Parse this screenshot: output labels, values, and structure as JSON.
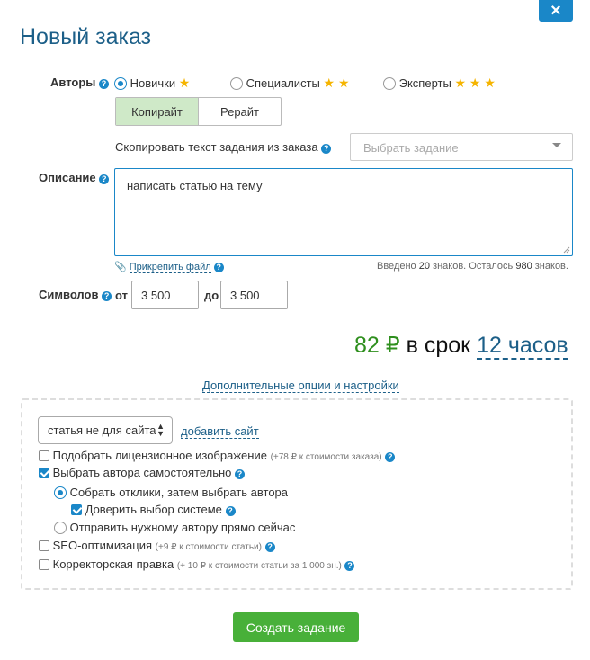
{
  "dialog": {
    "title": "Новый заказ",
    "close_icon": "×"
  },
  "authors": {
    "label": "Авторы",
    "options": [
      {
        "label": "Новички",
        "stars": "★",
        "selected": true
      },
      {
        "label": "Специалисты",
        "stars": "★ ★",
        "selected": false
      },
      {
        "label": "Эксперты",
        "stars": "★ ★ ★",
        "selected": false
      }
    ]
  },
  "type_tabs": [
    {
      "label": "Копирайт",
      "active": true
    },
    {
      "label": "Рерайт",
      "active": false
    }
  ],
  "copy_task": {
    "label": "Скопировать текст задания из заказа",
    "placeholder": "Выбрать задание"
  },
  "description": {
    "label": "Описание",
    "value": "написать статью на тему",
    "attach_link": "Прикрепить файл",
    "counter": {
      "prefix": "Введено",
      "entered": "20",
      "middle": "знаков. Осталось",
      "remaining": "980",
      "suffix": "знаков."
    }
  },
  "symbols": {
    "label": "Символов",
    "from_label": "от",
    "from_value": "3 500",
    "to_label": "до",
    "to_value": "3 500"
  },
  "price": {
    "amount": "82 ₽",
    "term_prefix": "в срок",
    "term": "12 часов"
  },
  "extra_options_link": "Дополнительные опции и настройки",
  "site": {
    "select_value": "статья не для сайта",
    "add_link": "добавить сайт"
  },
  "options": {
    "license_image": {
      "label": "Подобрать лицензионное изображение",
      "note": "(+78 ₽ к стоимости заказа)",
      "checked": false
    },
    "choose_author": {
      "label": "Выбрать автора самостоятельно",
      "checked": true
    },
    "collect_responses": {
      "label": "Собрать отклики, затем выбрать автора",
      "selected": true
    },
    "trust_system": {
      "label": "Доверить выбор системе",
      "checked": true
    },
    "send_now": {
      "label": "Отправить нужному автору прямо сейчас",
      "selected": false
    },
    "seo": {
      "label": "SEO-оптимизация",
      "note": "(+9 ₽ к стоимости статьи)",
      "checked": false
    },
    "proofreading": {
      "label": "Корректорская правка",
      "note": "(+ 10 ₽ к стоимости статьи за 1 000 зн.)",
      "checked": false
    }
  },
  "submit_label": "Создать задание",
  "colors": {
    "accent": "#1a87c8",
    "title": "#1c5f88",
    "price_green": "#2f8f1e",
    "button_green": "#48b039",
    "tab_active": "#cfe9c8",
    "star": "#f5b400"
  }
}
